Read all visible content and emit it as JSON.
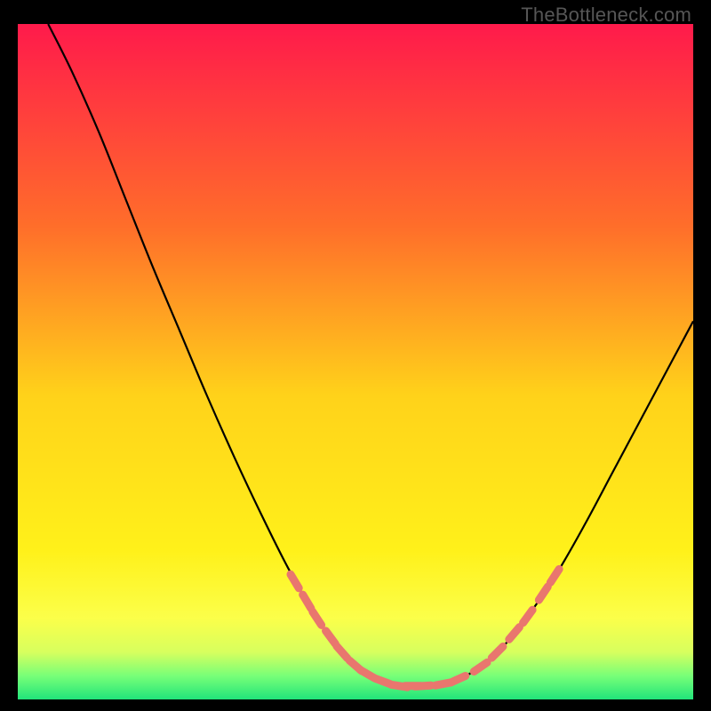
{
  "watermark": "TheBottleneck.com",
  "chart_data": {
    "type": "line",
    "title": "",
    "xlabel": "",
    "ylabel": "",
    "xlim": [
      0,
      100
    ],
    "ylim": [
      0,
      100
    ],
    "grid": false,
    "legend": false,
    "gradient_stops": [
      {
        "offset": 0.0,
        "color": "#ff1a4b"
      },
      {
        "offset": 0.3,
        "color": "#ff6e2a"
      },
      {
        "offset": 0.55,
        "color": "#ffd21a"
      },
      {
        "offset": 0.78,
        "color": "#fff11a"
      },
      {
        "offset": 0.88,
        "color": "#fbff4a"
      },
      {
        "offset": 0.93,
        "color": "#d7ff5e"
      },
      {
        "offset": 0.965,
        "color": "#78ff78"
      },
      {
        "offset": 1.0,
        "color": "#21e47a"
      }
    ],
    "series": [
      {
        "name": "curve",
        "color": "#000000",
        "points": [
          {
            "x": 4.5,
            "y": 100.0
          },
          {
            "x": 8.0,
            "y": 93.0
          },
          {
            "x": 12.0,
            "y": 84.0
          },
          {
            "x": 16.0,
            "y": 74.0
          },
          {
            "x": 20.0,
            "y": 64.0
          },
          {
            "x": 24.0,
            "y": 54.5
          },
          {
            "x": 28.0,
            "y": 45.0
          },
          {
            "x": 32.0,
            "y": 36.0
          },
          {
            "x": 36.0,
            "y": 27.5
          },
          {
            "x": 40.0,
            "y": 19.5
          },
          {
            "x": 44.0,
            "y": 12.5
          },
          {
            "x": 48.0,
            "y": 7.0
          },
          {
            "x": 52.0,
            "y": 3.5
          },
          {
            "x": 56.0,
            "y": 2.0
          },
          {
            "x": 60.0,
            "y": 2.0
          },
          {
            "x": 64.0,
            "y": 2.5
          },
          {
            "x": 68.0,
            "y": 4.5
          },
          {
            "x": 72.0,
            "y": 8.0
          },
          {
            "x": 76.0,
            "y": 13.0
          },
          {
            "x": 80.0,
            "y": 19.0
          },
          {
            "x": 84.0,
            "y": 26.0
          },
          {
            "x": 88.0,
            "y": 33.5
          },
          {
            "x": 92.0,
            "y": 41.0
          },
          {
            "x": 96.0,
            "y": 48.5
          },
          {
            "x": 100.0,
            "y": 56.0
          }
        ]
      },
      {
        "name": "highlight-markers",
        "color": "#e9766e",
        "points": [
          {
            "x": 41.0,
            "y": 17.5
          },
          {
            "x": 42.8,
            "y": 14.5
          },
          {
            "x": 44.3,
            "y": 12.0
          },
          {
            "x": 46.3,
            "y": 9.2
          },
          {
            "x": 48.0,
            "y": 7.0
          },
          {
            "x": 50.0,
            "y": 5.0
          },
          {
            "x": 51.7,
            "y": 3.8
          },
          {
            "x": 54.0,
            "y": 2.7
          },
          {
            "x": 56.5,
            "y": 2.0
          },
          {
            "x": 58.5,
            "y": 2.0
          },
          {
            "x": 60.0,
            "y": 2.0
          },
          {
            "x": 63.0,
            "y": 2.3
          },
          {
            "x": 65.2,
            "y": 3.0
          },
          {
            "x": 68.5,
            "y": 4.8
          },
          {
            "x": 71.0,
            "y": 7.0
          },
          {
            "x": 73.5,
            "y": 9.8
          },
          {
            "x": 75.5,
            "y": 12.3
          },
          {
            "x": 77.8,
            "y": 15.7
          },
          {
            "x": 79.5,
            "y": 18.3
          }
        ]
      }
    ]
  }
}
